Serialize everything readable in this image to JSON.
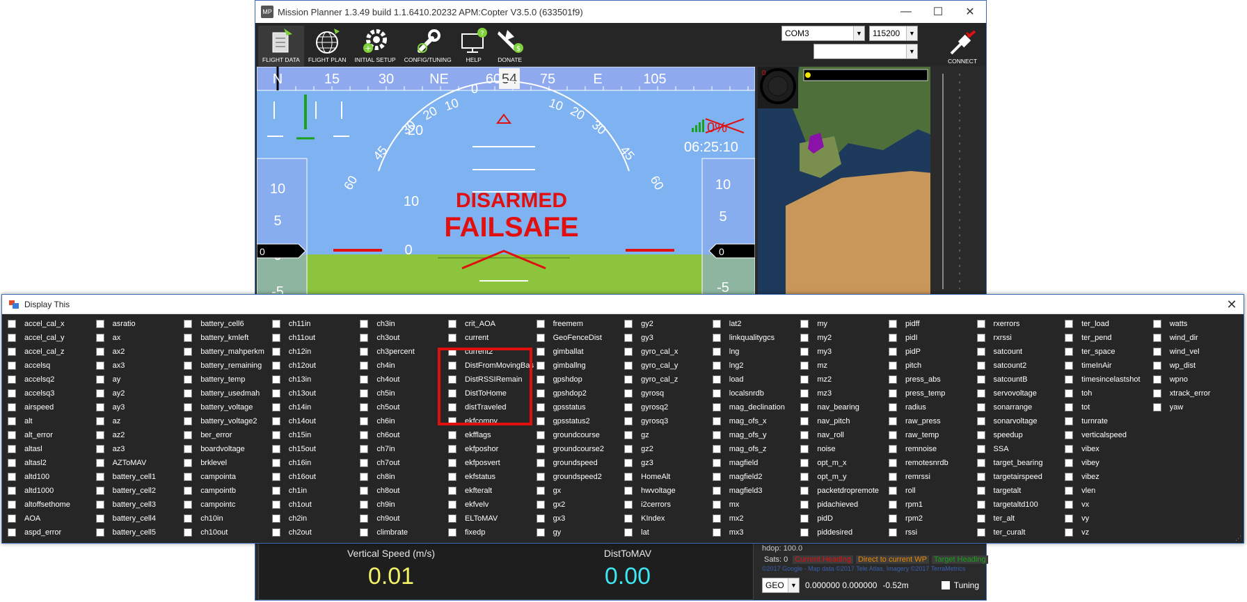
{
  "main_window": {
    "title": "Mission Planner 1.3.49 build 1.1.6410.20232 APM:Copter V3.5.0 (633501f9)",
    "app_icon_text": "MP",
    "controls": {
      "minimize": "—",
      "maximize": "☐",
      "close": "✕"
    },
    "menu": [
      {
        "label": "FLIGHT DATA",
        "icon": "flight-data-icon"
      },
      {
        "label": "FLIGHT PLAN",
        "icon": "globe-icon"
      },
      {
        "label": "INITIAL SETUP",
        "icon": "gear-icon"
      },
      {
        "label": "CONFIG/TUNING",
        "icon": "wrench-icon"
      },
      {
        "label": "HELP",
        "icon": "help-monitor-icon"
      },
      {
        "label": "DONATE",
        "icon": "donate-plane-icon"
      }
    ],
    "port": "COM3",
    "baud": "115200",
    "connect_label": "CONNECT"
  },
  "hud": {
    "heading_labels": [
      "N",
      "15",
      "30",
      "NE",
      "60",
      "75",
      "E",
      "105"
    ],
    "heading_value": "54",
    "pitch_labels": [
      "10",
      "20",
      "30",
      "45",
      "60"
    ],
    "pitch_marks": [
      "20",
      "10",
      "0"
    ],
    "status_main": "DISARMED",
    "status_fail": "FAILSAFE",
    "battery": "0%",
    "time": "06:25:10",
    "speed_tape": [
      "10",
      "5",
      "0",
      "-5"
    ],
    "alt_tape": [
      "10",
      "5",
      "0",
      "-5"
    ],
    "speed_value": "0",
    "alt_value": "0",
    "colors": {
      "sky": "#7fb2f0",
      "ground": "#7fbf3a",
      "alert": "#e01010"
    }
  },
  "map": {
    "counter": "0",
    "hdop": "hdop: 100.0",
    "sats": "Sats: 0",
    "legend": [
      {
        "text": "Current Heading",
        "color": "#e01010"
      },
      {
        "text": "Direct to current WP",
        "color": "#f08a00"
      },
      {
        "text": "Target Heading",
        "color": "#1aa01a"
      }
    ],
    "copyright": "©2017 Google - Map data ©2017 Tele Atlas, Imagery ©2017 TerraMetrics",
    "geo_mode": "GEO",
    "coords": "0.000000 0.000000",
    "altitude": "-0.52m",
    "tuning_label": "Tuning"
  },
  "quick_view": [
    {
      "label": "Vertical Speed (m/s)",
      "value": "0.01",
      "color": "#f3f36a"
    },
    {
      "label": "DistToMAV",
      "value": "0.00",
      "color": "#3ee6f2"
    }
  ],
  "dialog": {
    "title": "Display This",
    "close": "✕",
    "options": [
      "accel_cal_x",
      "accel_cal_y",
      "accel_cal_z",
      "accelsq",
      "accelsq2",
      "accelsq3",
      "airspeed",
      "alt",
      "alt_error",
      "altasl",
      "altasl2",
      "altd100",
      "altd1000",
      "altoffsethome",
      "AOA",
      "aspd_error",
      "asratio",
      "ax",
      "ax2",
      "ax3",
      "ay",
      "ay2",
      "ay3",
      "az",
      "az2",
      "az3",
      "AZToMAV",
      "battery_cell1",
      "battery_cell2",
      "battery_cell3",
      "battery_cell4",
      "battery_cell5",
      "battery_cell6",
      "battery_kmleft",
      "battery_mahperkm",
      "battery_remaining",
      "battery_temp",
      "battery_usedmah",
      "battery_voltage",
      "battery_voltage2",
      "ber_error",
      "boardvoltage",
      "brklevel",
      "campointa",
      "campointb",
      "campointc",
      "ch10in",
      "ch10out",
      "ch11in",
      "ch11out",
      "ch12in",
      "ch12out",
      "ch13in",
      "ch13out",
      "ch14in",
      "ch14out",
      "ch15in",
      "ch15out",
      "ch16in",
      "ch16out",
      "ch1in",
      "ch1out",
      "ch2in",
      "ch2out",
      "ch3in",
      "ch3out",
      "ch3percent",
      "ch4in",
      "ch4out",
      "ch5in",
      "ch5out",
      "ch6in",
      "ch6out",
      "ch7in",
      "ch7out",
      "ch8in",
      "ch8out",
      "ch9in",
      "ch9out",
      "climbrate",
      "crit_AOA",
      "current",
      "current2",
      "DistFromMovingBas",
      "DistRSSIRemain",
      "DistToHome",
      "distTraveled",
      "ekfcompv",
      "ekfflags",
      "ekfposhor",
      "ekfposvert",
      "ekfstatus",
      "ekfteralt",
      "ekfvelv",
      "ELToMAV",
      "fixedp",
      "freemem",
      "GeoFenceDist",
      "gimballat",
      "gimballng",
      "gpshdop",
      "gpshdop2",
      "gpsstatus",
      "gpsstatus2",
      "groundcourse",
      "groundcourse2",
      "groundspeed",
      "groundspeed2",
      "gx",
      "gx2",
      "gx3",
      "gy",
      "gy2",
      "gy3",
      "gyro_cal_x",
      "gyro_cal_y",
      "gyro_cal_z",
      "gyrosq",
      "gyrosq2",
      "gyrosq3",
      "gz",
      "gz2",
      "gz3",
      "HomeAlt",
      "hwvoltage",
      "i2cerrors",
      "KIndex",
      "lat",
      "lat2",
      "linkqualitygcs",
      "lng",
      "lng2",
      "load",
      "localsnrdb",
      "mag_declination",
      "mag_ofs_x",
      "mag_ofs_y",
      "mag_ofs_z",
      "magfield",
      "magfield2",
      "magfield3",
      "mx",
      "mx2",
      "mx3",
      "my",
      "my2",
      "my3",
      "mz",
      "mz2",
      "mz3",
      "nav_bearing",
      "nav_pitch",
      "nav_roll",
      "noise",
      "opt_m_x",
      "opt_m_y",
      "packetdropremote",
      "pidachieved",
      "pidD",
      "piddesired",
      "pidff",
      "pidI",
      "pidP",
      "pitch",
      "press_abs",
      "press_temp",
      "radius",
      "raw_press",
      "raw_temp",
      "remnoise",
      "remotesnrdb",
      "remrssi",
      "roll",
      "rpm1",
      "rpm2",
      "rssi",
      "rxerrors",
      "rxrssi",
      "satcount",
      "satcount2",
      "satcountB",
      "servovoltage",
      "sonarrange",
      "sonarvoltage",
      "speedup",
      "SSA",
      "target_bearing",
      "targetairspeed",
      "targetalt",
      "targetaltd100",
      "ter_alt",
      "ter_curalt",
      "ter_load",
      "ter_pend",
      "ter_space",
      "timeInAir",
      "timesincelastshot",
      "toh",
      "tot",
      "turnrate",
      "verticalspeed",
      "vibex",
      "vibey",
      "vibez",
      "vlen",
      "vx",
      "vy",
      "vz",
      "watts",
      "wind_dir",
      "wind_vel",
      "wp_dist",
      "wpno",
      "xtrack_error",
      "yaw"
    ]
  }
}
